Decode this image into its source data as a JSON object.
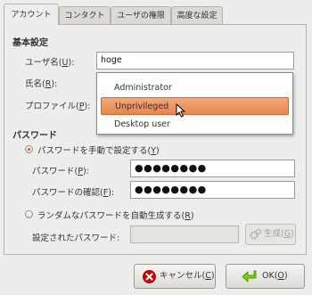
{
  "tabs": [
    {
      "label": "アカウント"
    },
    {
      "label": "コンタクト"
    },
    {
      "label": "ユーザの権限"
    },
    {
      "label": "高度な設定"
    }
  ],
  "basic": {
    "section_title": "基本設定",
    "username_label_main": "ユーザ名(",
    "username_label_key": "U",
    "username_label_end": "):",
    "username_value": "hoge",
    "realname_label_main": "氏名(",
    "realname_label_key": "R",
    "realname_label_end": "):",
    "profile_label_main": "プロファイル(",
    "profile_label_key": "P",
    "profile_label_end": "):"
  },
  "profile_menu": {
    "items": [
      "Administrator",
      "Unprivileged",
      "Desktop user"
    ],
    "highlighted": "Unprivileged"
  },
  "password": {
    "section_title": "パスワード",
    "manual_radio_main": "パスワードを手動で設定する(",
    "manual_radio_key": "Y",
    "manual_radio_end": ")",
    "pw_label_main": "パスワード(",
    "pw_label_key": "P",
    "pw_label_end": "):",
    "pw_value": "●●●●●●●●",
    "confirm_label_main": "パスワードの確認(",
    "confirm_label_key": "F",
    "confirm_label_end": "):",
    "confirm_value": "●●●●●●●●",
    "random_radio_main": "ランダムなパスワードを自動生成する(",
    "random_radio_key": "R",
    "random_radio_end": ")",
    "generated_label": "設定されたパスワード:",
    "generate_button_main": "生成(",
    "generate_button_key": "G",
    "generate_button_end": ")"
  },
  "buttons": {
    "cancel_main": "キャンセル(",
    "cancel_key": "C",
    "cancel_end": ")",
    "ok_main": "OK(",
    "ok_key": "O",
    "ok_end": ")"
  },
  "colors": {
    "accent": "#e8864d",
    "cancel_icon": "#cc0000",
    "ok_icon": "#4e9a06"
  }
}
